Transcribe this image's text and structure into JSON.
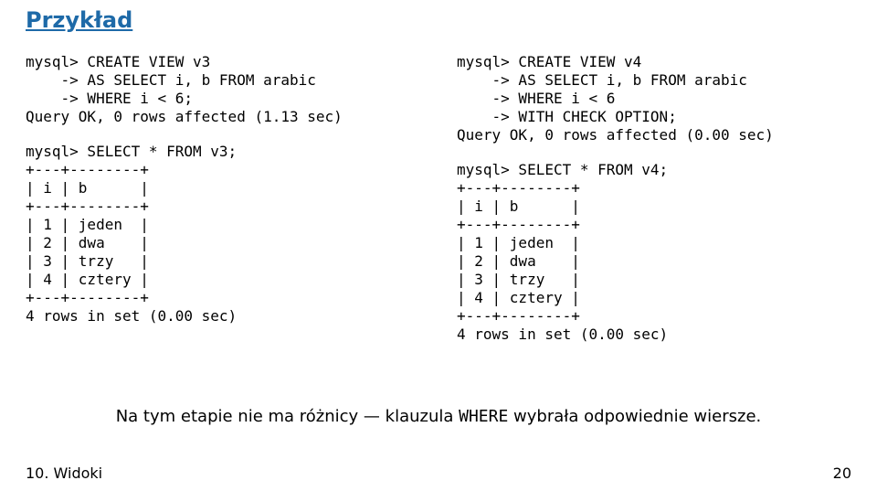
{
  "title": "Przykład",
  "left": {
    "create": "mysql> CREATE VIEW v3\n    -> AS SELECT i, b FROM arabic\n    -> WHERE i < 6;\nQuery OK, 0 rows affected (1.13 sec)",
    "select": "mysql> SELECT * FROM v3;\n+---+--------+\n| i | b      |\n+---+--------+\n| 1 | jeden  |\n| 2 | dwa    |\n| 3 | trzy   |\n| 4 | cztery |\n+---+--------+\n4 rows in set (0.00 sec)"
  },
  "right": {
    "create": "mysql> CREATE VIEW v4\n    -> AS SELECT i, b FROM arabic\n    -> WHERE i < 6\n    -> WITH CHECK OPTION;\nQuery OK, 0 rows affected (0.00 sec)",
    "select": "mysql> SELECT * FROM v4;\n+---+--------+\n| i | b      |\n+---+--------+\n| 1 | jeden  |\n| 2 | dwa    |\n| 3 | trzy   |\n| 4 | cztery |\n+---+--------+\n4 rows in set (0.00 sec)"
  },
  "caption_pre": "Na tym etapie nie ma różnicy — klauzula ",
  "caption_code": "WHERE",
  "caption_post": " wybrała odpowiednie wiersze.",
  "footer_left": "10. Widoki",
  "footer_right": "20"
}
